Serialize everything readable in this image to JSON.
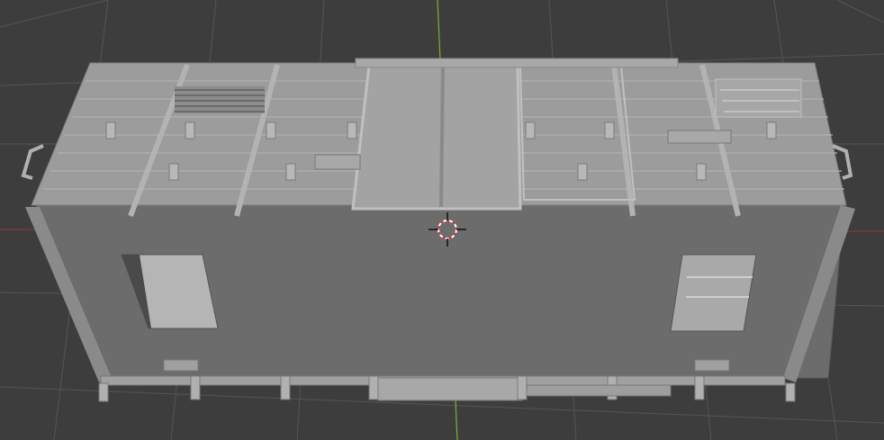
{
  "viewport": {
    "mode": "3d-viewport",
    "background_color": "#3d3d3d",
    "grid_color": "#555555",
    "x_axis_color": "#8a3a3a",
    "y_axis_color": "#7fae2f"
  },
  "scene": {
    "object": "boxcar-body-model",
    "object_color": "#9a9a9a",
    "side_color": "#6c6c6c",
    "roof_color": "#9c9c9c",
    "cursor_icon": "3d-cursor-icon"
  }
}
